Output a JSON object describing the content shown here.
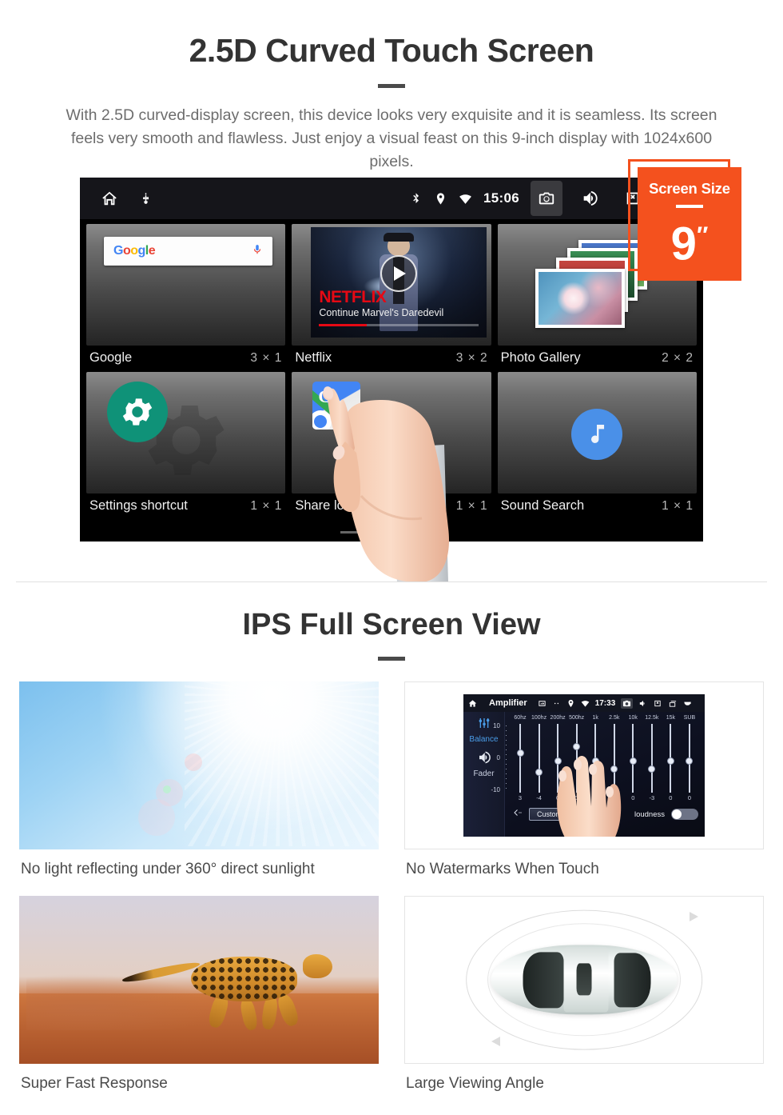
{
  "section1": {
    "title": "2.5D Curved Touch Screen",
    "description": "With 2.5D curved-display screen, this device looks very exquisite and it is seamless. Its screen feels very smooth and flawless. Just enjoy a visual feast on this 9-inch display with 1024x600 pixels."
  },
  "badge": {
    "title": "Screen Size",
    "value": "9",
    "unit": "″"
  },
  "device": {
    "statusbar": {
      "clock": "15:06",
      "left_icons": [
        "home-icon",
        "usb-icon"
      ],
      "right_icons": [
        "bluetooth-icon",
        "location-icon",
        "wifi-icon",
        "camera-icon",
        "volume-icon",
        "close-box-icon",
        "recent-apps-icon"
      ]
    },
    "widgets": [
      {
        "name": "Google",
        "size": "3 × 1",
        "search_placeholder": "",
        "logo": "Google"
      },
      {
        "name": "Netflix",
        "size": "3 × 2",
        "brand": "NETFLIX",
        "subtitle": "Continue Marvel's Daredevil"
      },
      {
        "name": "Photo Gallery",
        "size": "2 × 2"
      },
      {
        "name": "Settings shortcut",
        "size": "1 × 1"
      },
      {
        "name": "Share location",
        "size": "1 × 1"
      },
      {
        "name": "Sound Search",
        "size": "1 × 1"
      }
    ],
    "page_indicator": {
      "count": 3,
      "active": 3
    }
  },
  "section2": {
    "title": "IPS Full Screen View",
    "cells": [
      {
        "caption": "No light reflecting under 360° direct sunlight"
      },
      {
        "caption": "No Watermarks When Touch"
      },
      {
        "caption": "Super Fast Response"
      },
      {
        "caption": "Large Viewing Angle"
      }
    ]
  },
  "amplifier": {
    "title": "Amplifier",
    "clock": "17:33",
    "side_tabs": [
      "Balance",
      "Fader"
    ],
    "scale": {
      "top": "10",
      "mid": "0",
      "bottom": "-10"
    },
    "bands": [
      "60hz",
      "100hz",
      "200hz",
      "500hz",
      "1k",
      "2.5k",
      "10k",
      "12.5k",
      "15k",
      "SUB"
    ],
    "values": [
      "3",
      "-4",
      "0",
      "0",
      "0",
      "-3",
      "0",
      "-3",
      "0",
      "0"
    ],
    "preset_label": "Custom",
    "loudness_label": "loudness"
  },
  "colors": {
    "accent": "#f4511e",
    "title": "#333333",
    "body_text": "#6d6d6d",
    "netflix_red": "#E50914",
    "settings_green": "#0f9278",
    "sound_blue": "#4a90e8"
  }
}
